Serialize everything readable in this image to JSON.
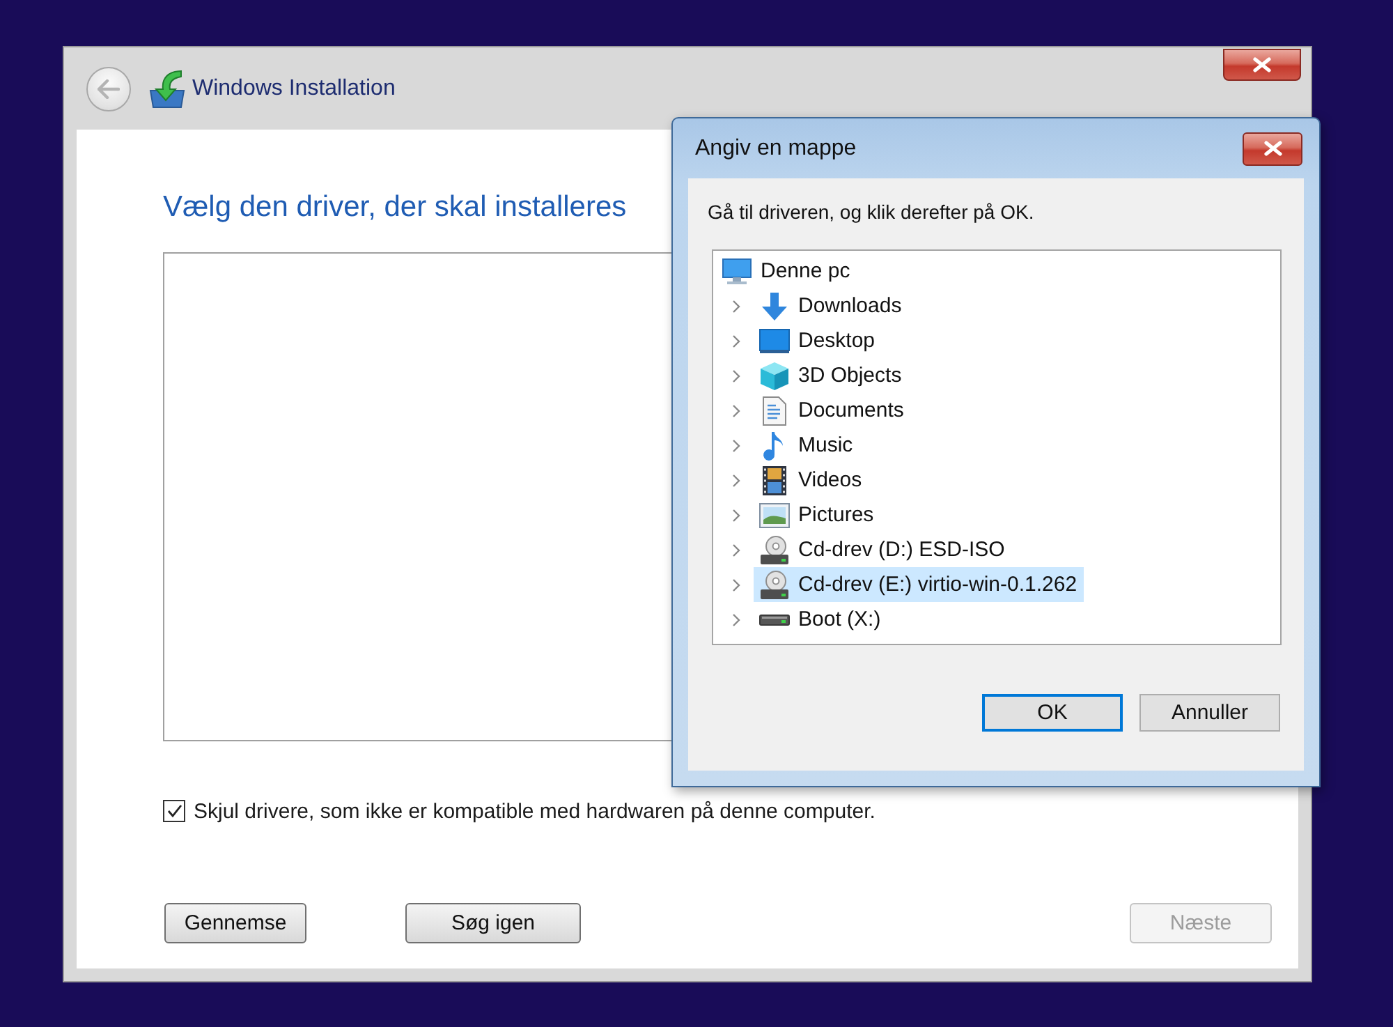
{
  "main_window": {
    "title": "Windows Installation",
    "heading": "Vælg den driver, der skal installeres",
    "hide_incompatible": {
      "label": "Skjul drivere, som ikke er kompatible med hardwaren på denne computer.",
      "checked": true
    },
    "buttons": [
      {
        "label": "Gennemse",
        "disabled": false
      },
      {
        "label": "Søg igen",
        "disabled": false
      },
      {
        "label": "Næste",
        "disabled": true
      }
    ]
  },
  "dialog": {
    "title": "Angiv en mappe",
    "instruction": "Gå til driveren, og klik derefter på OK.",
    "tree": {
      "label": "Denne pc",
      "kind": "computer",
      "selected": false,
      "children": [
        {
          "label": "Downloads",
          "kind": "downloads",
          "expanded": false,
          "selected": false
        },
        {
          "label": "Desktop",
          "kind": "desktop",
          "expanded": false,
          "selected": false
        },
        {
          "label": "3D Objects",
          "kind": "cube",
          "expanded": false,
          "selected": false
        },
        {
          "label": "Documents",
          "kind": "documents",
          "expanded": false,
          "selected": false
        },
        {
          "label": "Music",
          "kind": "music",
          "expanded": false,
          "selected": false
        },
        {
          "label": "Videos",
          "kind": "videos",
          "expanded": false,
          "selected": false
        },
        {
          "label": "Pictures",
          "kind": "pictures",
          "expanded": false,
          "selected": false
        },
        {
          "label": "Cd-drev (D:) ESD-ISO",
          "kind": "cd-drive",
          "expanded": false,
          "selected": false
        },
        {
          "label": "Cd-drev (E:) virtio-win-0.1.262",
          "kind": "cd-drive",
          "expanded": false,
          "selected": true
        },
        {
          "label": "Boot (X:)",
          "kind": "drive",
          "expanded": false,
          "selected": false
        }
      ]
    },
    "buttons": [
      {
        "label": "OK",
        "default": true
      },
      {
        "label": "Annuller",
        "default": false
      }
    ]
  }
}
